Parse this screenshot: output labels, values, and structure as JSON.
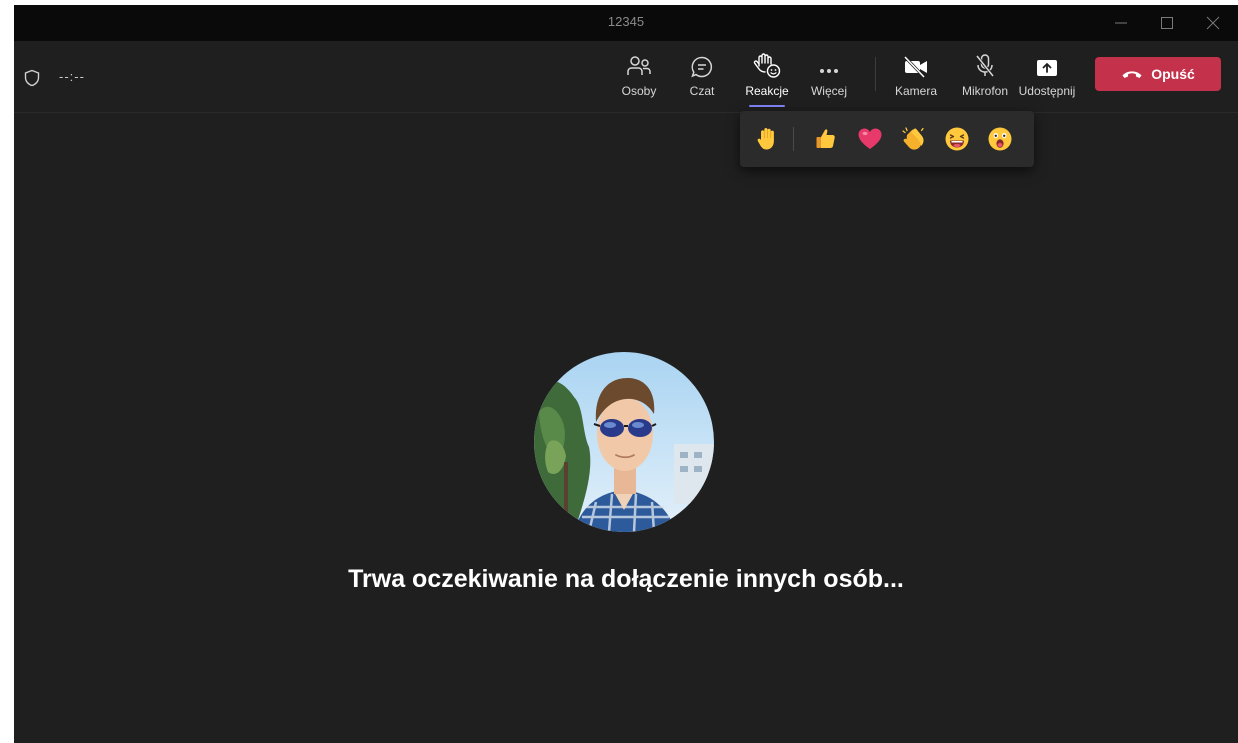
{
  "window": {
    "title": "12345"
  },
  "meeting": {
    "timer": "--:--",
    "waiting_text": "Trwa oczekiwanie na dołączenie innych osób..."
  },
  "toolbar": {
    "people_label": "Osoby",
    "chat_label": "Czat",
    "reactions_label": "Reakcje",
    "more_label": "Więcej",
    "camera_label": "Kamera",
    "mic_label": "Mikrofon",
    "share_label": "Udostępnij",
    "leave_label": "Opuść"
  },
  "reactions": {
    "items": [
      "raise-hand",
      "like",
      "heart",
      "applause",
      "laugh",
      "surprised"
    ]
  },
  "colors": {
    "accent": "#7f85f5",
    "leave": "#c4314b",
    "background": "#1f1f1f"
  }
}
